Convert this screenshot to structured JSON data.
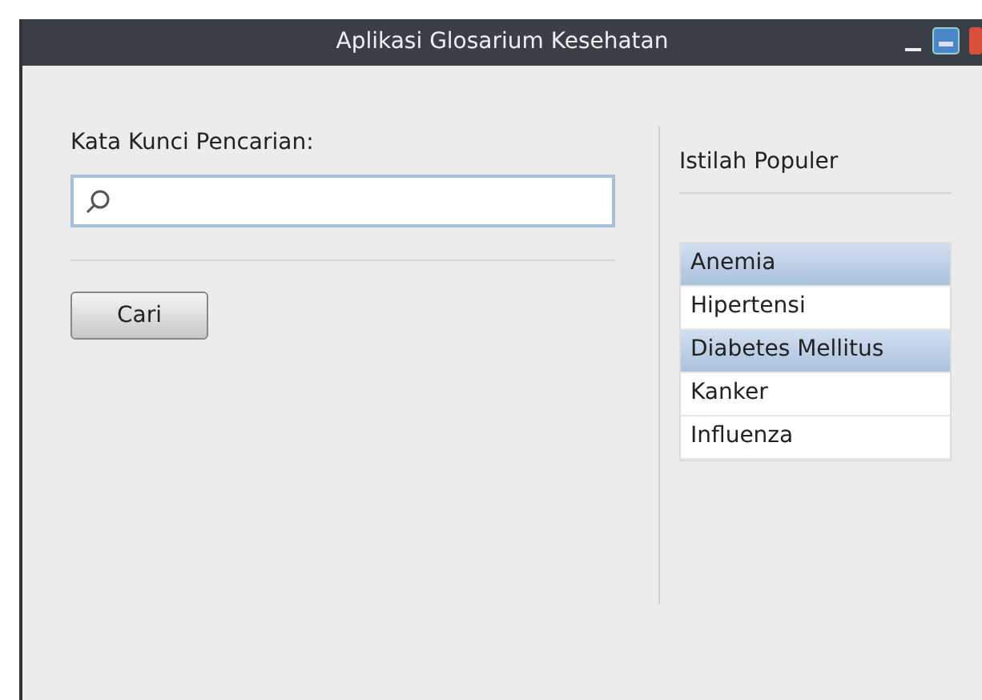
{
  "window": {
    "title": "Aplikasi Glosarium Kesehatan"
  },
  "search": {
    "label": "Kata Kunci Pencarian:"
  },
  "search_button": "Cari",
  "popular": {
    "title": "Istilah Populer",
    "items": [
      {
        "label": "Anemia",
        "selected": true
      },
      {
        "label": "Hipertensi",
        "selected": false
      },
      {
        "label": "Diabetes Mellitus",
        "selected": true
      },
      {
        "label": "Kanker",
        "selected": false
      },
      {
        "label": "Influenza",
        "selected": false
      }
    ]
  }
}
